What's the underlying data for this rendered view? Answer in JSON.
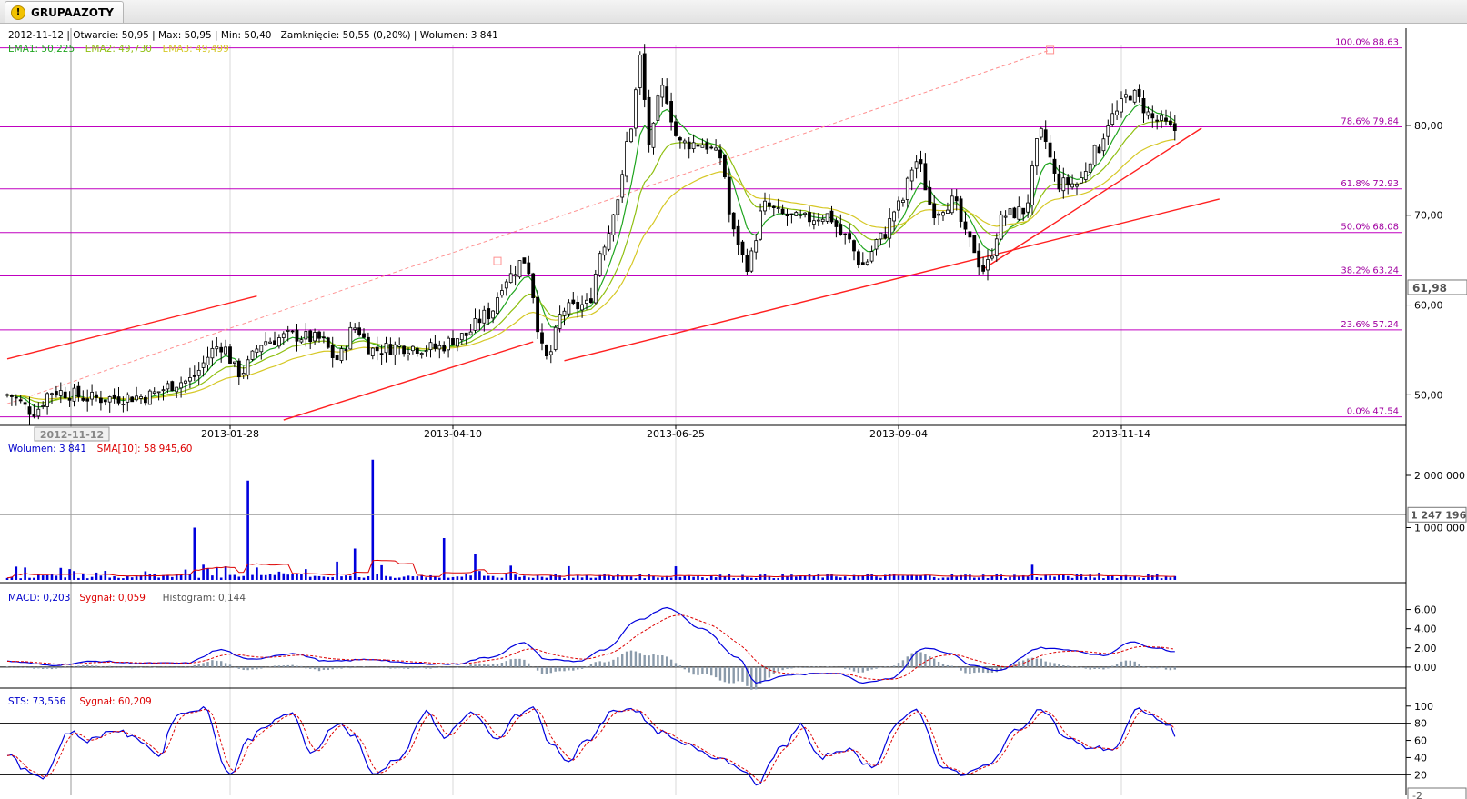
{
  "tab": {
    "title": "GRUPAAZOTY",
    "icon": "warning-icon"
  },
  "info_line": "2012-11-12 | Otwarcie: 50,95 | Max: 50,95 | Min: 50,40 | Zamknięcie: 50,55 (0,20%) | Wolumen: 3 841",
  "ema_legend": [
    {
      "text": "EMA1: 50,225",
      "color": "#1fa51f"
    },
    {
      "text": "EMA2: 49,730",
      "color": "#8fbf10"
    },
    {
      "text": "EMA3: 49,499",
      "color": "#d6c826"
    }
  ],
  "volume_legend": [
    {
      "text": "Wolumen: 3 841",
      "color": "#0000cc"
    },
    {
      "text": "SMA[10]: 58 945,60",
      "color": "#dd0000"
    }
  ],
  "macd_legend": [
    {
      "text": "MACD: 0,203",
      "color": "#0000cc"
    },
    {
      "text": "Sygnał: 0,059",
      "color": "#dd0000"
    },
    {
      "text": "Histogram: 0,144",
      "color": "#555555"
    }
  ],
  "sts_legend": [
    {
      "text": "STS: 73,556",
      "color": "#0000cc"
    },
    {
      "text": "Sygnał: 60,209",
      "color": "#dd0000"
    }
  ],
  "chart_data": {
    "type": "candlestick",
    "x_axis": {
      "labels": [
        "2013-01-28",
        "2013-04-10",
        "2013-06-25",
        "2013-09-04",
        "2013-11-14"
      ],
      "label_positions_idx": [
        50,
        100,
        150,
        200,
        250
      ],
      "cursor_label": "2012-11-12"
    },
    "price_axis": {
      "ticks": [
        "50,00",
        "60,00",
        "70,00",
        "80,00"
      ],
      "tick_values": [
        50,
        60,
        70,
        80
      ],
      "range": [
        47,
        89
      ],
      "marker": "61,98"
    },
    "fibonacci": [
      {
        "label": "100.0% 88.63",
        "value": 88.63
      },
      {
        "label": "78.6% 79.84",
        "value": 79.84
      },
      {
        "label": "61.8% 72.93",
        "value": 72.93
      },
      {
        "label": "50.0% 68.08",
        "value": 68.08
      },
      {
        "label": "38.2% 63.24",
        "value": 63.24
      },
      {
        "label": "23.6% 57.24",
        "value": 57.24
      },
      {
        "label": "0.0% 47.54",
        "value": 47.54
      }
    ],
    "price_keypoints": [
      [
        0,
        50.0
      ],
      [
        6,
        48.2
      ],
      [
        10,
        50.4
      ],
      [
        20,
        49.6
      ],
      [
        30,
        49.8
      ],
      [
        40,
        51.5
      ],
      [
        48,
        55.5
      ],
      [
        52,
        52.5
      ],
      [
        58,
        56.0
      ],
      [
        64,
        56.6
      ],
      [
        70,
        56.2
      ],
      [
        74,
        54.0
      ],
      [
        78,
        57.5
      ],
      [
        82,
        55.0
      ],
      [
        88,
        55.4
      ],
      [
        96,
        55.2
      ],
      [
        102,
        56.5
      ],
      [
        108,
        59.0
      ],
      [
        112,
        63.0
      ],
      [
        116,
        65.0
      ],
      [
        121,
        54.0
      ],
      [
        125,
        59.5
      ],
      [
        130,
        60.0
      ],
      [
        134,
        67.0
      ],
      [
        137,
        72.0
      ],
      [
        140,
        80.0
      ],
      [
        142,
        87.5
      ],
      [
        144,
        78.0
      ],
      [
        147,
        84.0
      ],
      [
        151,
        78.0
      ],
      [
        156,
        78.0
      ],
      [
        160,
        76.5
      ],
      [
        163,
        68.0
      ],
      [
        166,
        64.5
      ],
      [
        170,
        71.0
      ],
      [
        174,
        70.0
      ],
      [
        178,
        69.5
      ],
      [
        184,
        70.0
      ],
      [
        188,
        67.5
      ],
      [
        192,
        64.5
      ],
      [
        196,
        67.5
      ],
      [
        200,
        71.0
      ],
      [
        204,
        76.0
      ],
      [
        208,
        70.5
      ],
      [
        212,
        71.5
      ],
      [
        216,
        67.0
      ],
      [
        219,
        64.0
      ],
      [
        224,
        70.0
      ],
      [
        228,
        70.5
      ],
      [
        232,
        79.0
      ],
      [
        236,
        73.5
      ],
      [
        240,
        73.5
      ],
      [
        244,
        77.0
      ],
      [
        248,
        81.0
      ],
      [
        252,
        83.5
      ],
      [
        258,
        80.5
      ],
      [
        262,
        79.5
      ]
    ],
    "trend_lines": [
      {
        "from": [
          0,
          54.0
        ],
        "to": [
          56,
          61.0
        ],
        "color": "#ff2020"
      },
      {
        "from": [
          62,
          47.2
        ],
        "to": [
          118,
          55.9
        ],
        "color": "#ff2020"
      },
      {
        "from": [
          125,
          53.8
        ],
        "to": [
          272,
          71.8
        ],
        "color": "#ff2020"
      },
      {
        "from": [
          219,
          64.0
        ],
        "to": [
          268,
          79.7
        ],
        "color": "#ff2020"
      },
      {
        "from": [
          0,
          49.0
        ],
        "to": [
          234,
          88.4
        ],
        "color": "#ff9090",
        "dashed": true
      }
    ],
    "volume": {
      "ticks": [
        "1 000 000",
        "2 000 000"
      ],
      "tick_values": [
        1000000,
        2000000
      ],
      "marker": "1 247 196",
      "max": 2400000,
      "spikes": [
        [
          12,
          230000
        ],
        [
          42,
          1000000
        ],
        [
          54,
          1900000
        ],
        [
          74,
          350000
        ],
        [
          78,
          600000
        ],
        [
          82,
          2300000
        ],
        [
          98,
          800000
        ],
        [
          105,
          500000
        ],
        [
          150,
          260000
        ],
        [
          230,
          290000
        ],
        [
          245,
          140000
        ]
      ]
    },
    "macd": {
      "ticks": [
        "0,00",
        "2,00",
        "4,00",
        "6,00"
      ],
      "tick_values": [
        0,
        2,
        4,
        6
      ],
      "range": [
        -2,
        7
      ],
      "keypoints": [
        [
          0,
          0.6
        ],
        [
          10,
          0.2
        ],
        [
          20,
          0.6
        ],
        [
          30,
          0.4
        ],
        [
          40,
          0.4
        ],
        [
          48,
          1.8
        ],
        [
          54,
          0.8
        ],
        [
          64,
          1.4
        ],
        [
          72,
          0.6
        ],
        [
          82,
          0.8
        ],
        [
          90,
          0.4
        ],
        [
          100,
          0.3
        ],
        [
          108,
          1.0
        ],
        [
          116,
          2.5
        ],
        [
          121,
          0.8
        ],
        [
          128,
          0.6
        ],
        [
          134,
          1.8
        ],
        [
          142,
          5.0
        ],
        [
          148,
          6.2
        ],
        [
          156,
          4.0
        ],
        [
          164,
          1.0
        ],
        [
          168,
          -1.6
        ],
        [
          176,
          -0.8
        ],
        [
          186,
          -0.6
        ],
        [
          192,
          -1.6
        ],
        [
          198,
          -1.2
        ],
        [
          206,
          2.0
        ],
        [
          212,
          1.4
        ],
        [
          216,
          0.2
        ],
        [
          222,
          -0.4
        ],
        [
          232,
          2.0
        ],
        [
          238,
          1.8
        ],
        [
          246,
          1.2
        ],
        [
          252,
          2.6
        ],
        [
          258,
          2.0
        ],
        [
          262,
          1.6
        ]
      ]
    },
    "sts": {
      "ticks": [
        "20",
        "40",
        "60",
        "80",
        "100"
      ],
      "tick_values": [
        20,
        40,
        60,
        80,
        100
      ],
      "marker": "-2",
      "range": [
        -4,
        104
      ],
      "lines": [
        20,
        80
      ],
      "keypoints": [
        [
          0,
          45
        ],
        [
          4,
          25
        ],
        [
          8,
          18
        ],
        [
          14,
          70
        ],
        [
          18,
          60
        ],
        [
          24,
          72
        ],
        [
          30,
          60
        ],
        [
          34,
          42
        ],
        [
          38,
          90
        ],
        [
          44,
          98
        ],
        [
          50,
          20
        ],
        [
          54,
          60
        ],
        [
          58,
          78
        ],
        [
          64,
          92
        ],
        [
          68,
          44
        ],
        [
          74,
          80
        ],
        [
          78,
          65
        ],
        [
          82,
          20
        ],
        [
          88,
          40
        ],
        [
          94,
          92
        ],
        [
          98,
          65
        ],
        [
          104,
          92
        ],
        [
          110,
          60
        ],
        [
          114,
          88
        ],
        [
          118,
          98
        ],
        [
          122,
          55
        ],
        [
          126,
          36
        ],
        [
          130,
          60
        ],
        [
          136,
          94
        ],
        [
          140,
          98
        ],
        [
          146,
          70
        ],
        [
          152,
          55
        ],
        [
          160,
          40
        ],
        [
          164,
          30
        ],
        [
          168,
          10
        ],
        [
          174,
          52
        ],
        [
          178,
          78
        ],
        [
          182,
          40
        ],
        [
          188,
          50
        ],
        [
          194,
          30
        ],
        [
          200,
          80
        ],
        [
          204,
          96
        ],
        [
          210,
          30
        ],
        [
          214,
          20
        ],
        [
          220,
          30
        ],
        [
          226,
          70
        ],
        [
          232,
          96
        ],
        [
          238,
          62
        ],
        [
          242,
          52
        ],
        [
          248,
          50
        ],
        [
          254,
          96
        ],
        [
          260,
          80
        ],
        [
          264,
          46
        ]
      ]
    }
  }
}
